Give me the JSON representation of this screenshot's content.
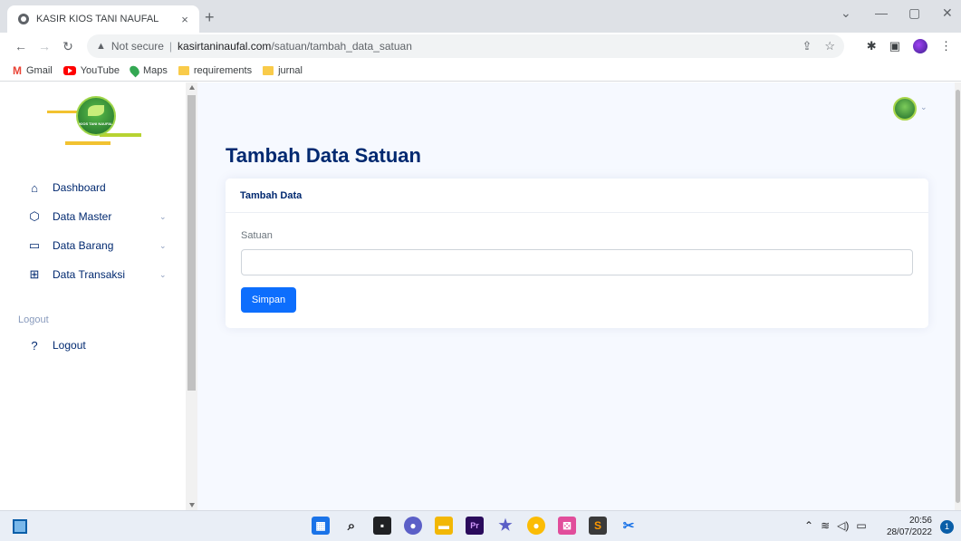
{
  "browser": {
    "tab_title": "KASIR KIOS TANI NAUFAL",
    "tab_close": "×",
    "new_tab": "+",
    "not_secure": "Not secure",
    "url_host": "kasirtaninaufal.com",
    "url_path": "/satuan/tambah_data_satuan",
    "bookmarks": [
      {
        "label": "Gmail"
      },
      {
        "label": "YouTube"
      },
      {
        "label": "Maps"
      },
      {
        "label": "requirements"
      },
      {
        "label": "jurnal"
      }
    ]
  },
  "sidebar": {
    "logo_text": "KIOS TANI NAUFAL",
    "items": [
      {
        "label": "Dashboard",
        "icon": "home-icon"
      },
      {
        "label": "Data Master",
        "icon": "box-icon"
      },
      {
        "label": "Data Barang",
        "icon": "card-icon"
      },
      {
        "label": "Data Transaksi",
        "icon": "grid-icon"
      }
    ],
    "heading": "Logout",
    "logout_label": "Logout"
  },
  "main": {
    "page_title": "Tambah Data Satuan",
    "card_title": "Tambah Data",
    "field_label": "Satuan",
    "field_value": "",
    "save_button": "Simpan"
  },
  "taskbar": {
    "time": "20:56",
    "date": "28/07/2022",
    "notifications": "1"
  },
  "colors": {
    "primary": "#0d6efd",
    "nav_text": "#012970",
    "page_bg": "#f6f9ff"
  }
}
